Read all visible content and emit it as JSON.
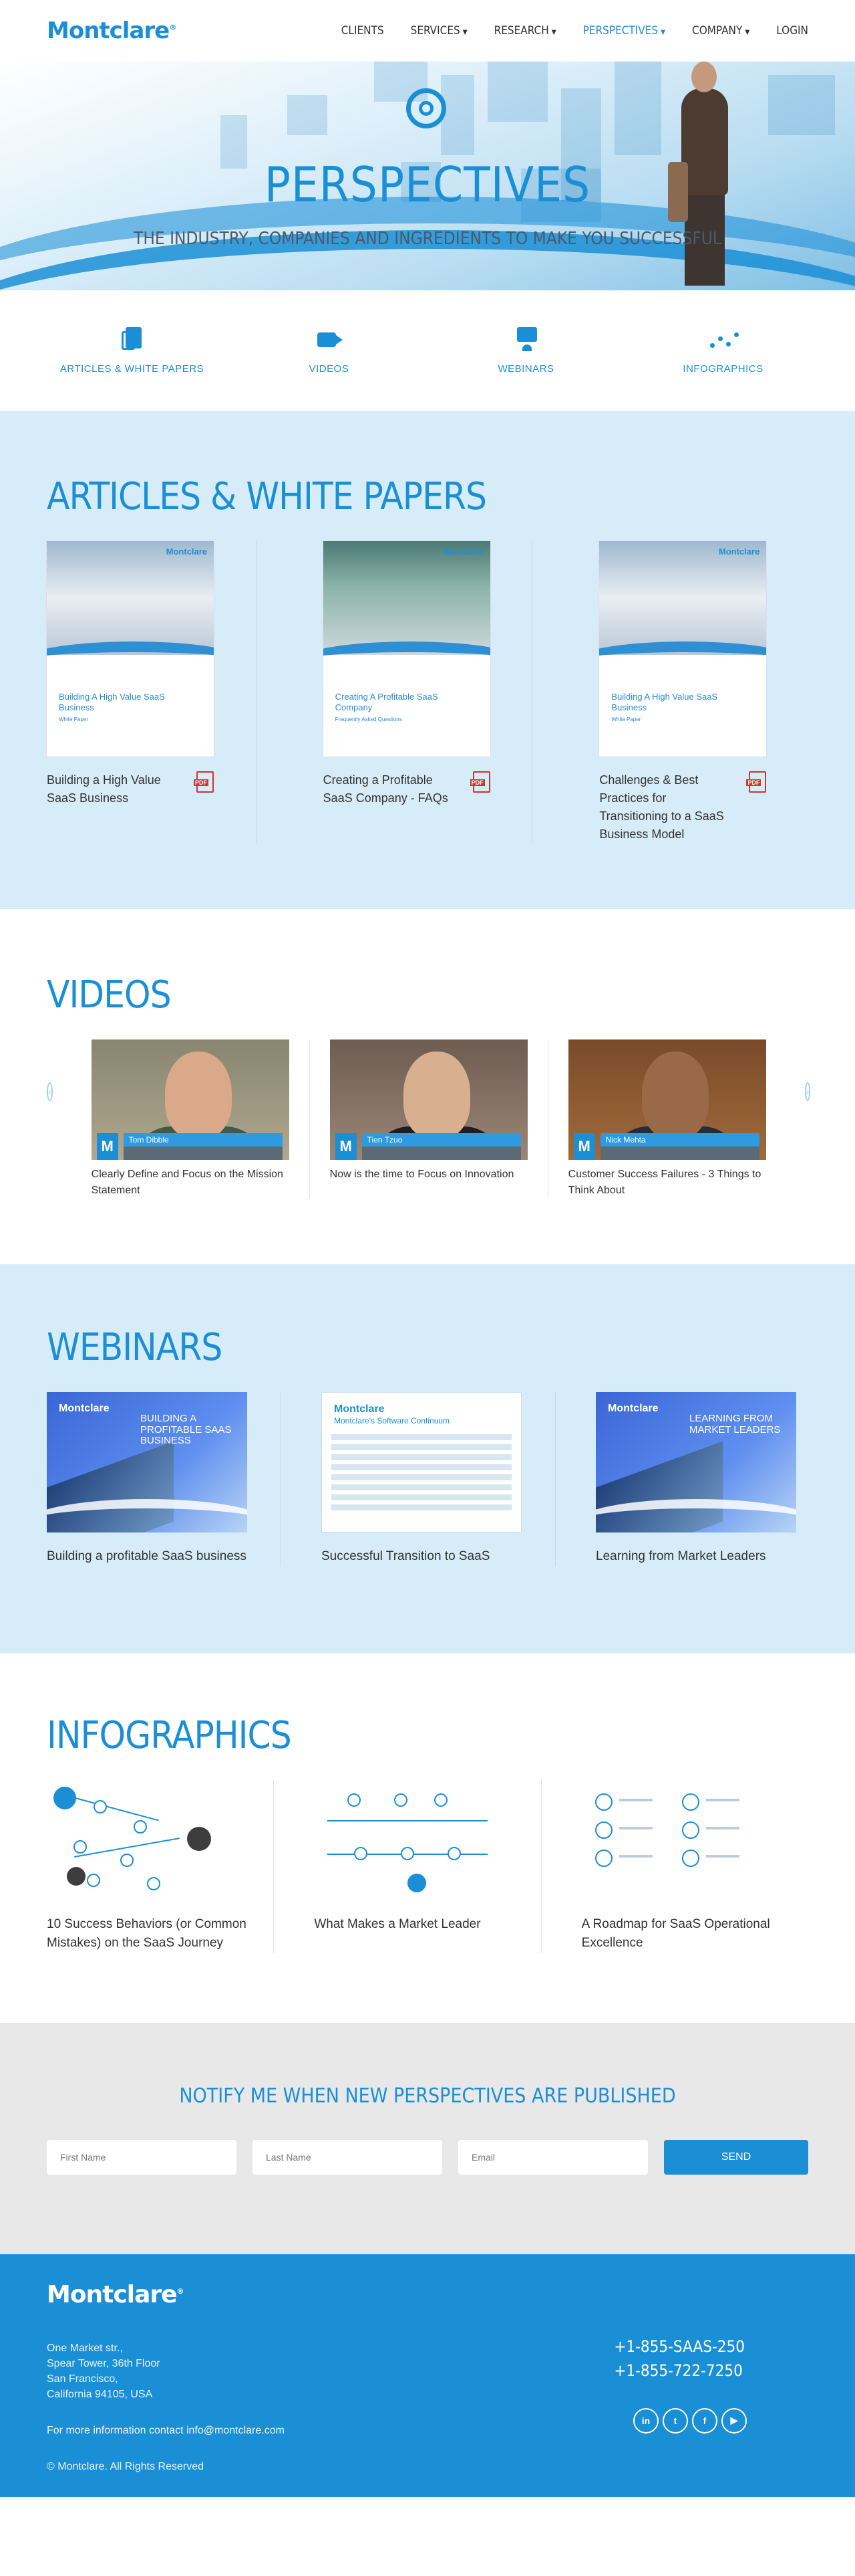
{
  "header": {
    "logo": "Montclare",
    "nav": [
      {
        "label": "CLIENTS",
        "caret": false,
        "active": false
      },
      {
        "label": "SERVICES",
        "caret": true,
        "active": false
      },
      {
        "label": "RESEARCH",
        "caret": true,
        "active": false
      },
      {
        "label": "PERSPECTIVES",
        "caret": true,
        "active": true
      },
      {
        "label": "COMPANY",
        "caret": true,
        "active": false
      },
      {
        "label": "LOGIN",
        "caret": false,
        "active": false
      }
    ]
  },
  "hero": {
    "title": "PERSPECTIVES",
    "subtitle": "THE INDUSTRY, COMPANIES AND INGREDIENTS TO MAKE YOU SUCCESSFUL"
  },
  "categories": [
    {
      "label": "ARTICLES & WHITE PAPERS",
      "icon": "document-icon"
    },
    {
      "label": "VIDEOS",
      "icon": "video-icon"
    },
    {
      "label": "WEBINARS",
      "icon": "webinar-icon"
    },
    {
      "label": "INFOGRAPHICS",
      "icon": "infographic-icon"
    }
  ],
  "articles": {
    "title": "ARTICLES & WHITE PAPERS",
    "items": [
      {
        "cover_brand": "Montclare",
        "cover_title": "Building A High Value SaaS Business",
        "cover_tag": "White Paper",
        "title": "Building a High Value SaaS Business"
      },
      {
        "cover_brand": "Montclare",
        "cover_title": "Creating A Profitable SaaS Company",
        "cover_tag": "Frequently Asked Questions",
        "title": "Creating a Profitable SaaS Company - FAQs"
      },
      {
        "cover_brand": "Montclare",
        "cover_title": "Building A High Value SaaS Business",
        "cover_tag": "White Paper",
        "title": "Challenges & Best Practices for Transitioning to a SaaS Business Model"
      }
    ]
  },
  "videos": {
    "title": "VIDEOS",
    "items": [
      {
        "speaker": "Tom Dibble",
        "caption": "Clearly Define and Focus on the Mission Statement"
      },
      {
        "speaker": "Tien Tzuo",
        "caption": "Now is the time to Focus on Innovation"
      },
      {
        "speaker": "Nick Mehta",
        "caption": "Customer Success Failures - 3 Things to Think About"
      }
    ]
  },
  "webinars": {
    "title": "WEBINARS",
    "items": [
      {
        "brand": "Montclare",
        "thumb_title": "BUILDING A PROFITABLE SAAS BUSINESS",
        "caption": "Building a profitable SaaS business",
        "style": "dark"
      },
      {
        "brand": "Montclare",
        "thumb_title": "Montclare's Software Continuum",
        "caption": "Successful Transition to SaaS",
        "style": "light"
      },
      {
        "brand": "Montclare",
        "thumb_title": "LEARNING FROM MARKET LEADERS",
        "caption": "Learning from Market Leaders",
        "style": "dark"
      }
    ]
  },
  "infographics": {
    "title": "INFOGRAPHICS",
    "items": [
      {
        "caption": "10 Success Behaviors (or Common Mistakes) on the SaaS Journey"
      },
      {
        "caption": "What Makes a Market Leader"
      },
      {
        "caption": "A Roadmap for SaaS Operational Excellence"
      }
    ]
  },
  "notify": {
    "title": "NOTIFY ME WHEN NEW PERSPECTIVES ARE PUBLISHED",
    "first_name_placeholder": "First Name",
    "last_name_placeholder": "Last Name",
    "email_placeholder": "Email",
    "send_label": "SEND"
  },
  "footer": {
    "logo": "Montclare",
    "address": [
      "One Market str.,",
      "Spear Tower, 36th Floor",
      "San Francisco,",
      "California 94105, USA"
    ],
    "contact": "For more information contact info@montclare.com",
    "phones": [
      "+1-855-SAAS-250",
      "+1-855-722-7250"
    ],
    "social": [
      {
        "name": "linkedin-icon",
        "glyph": "in"
      },
      {
        "name": "twitter-icon",
        "glyph": "t"
      },
      {
        "name": "facebook-icon",
        "glyph": "f"
      },
      {
        "name": "youtube-icon",
        "glyph": "▶"
      }
    ],
    "copyright": "© Montclare. All Rights Reserved"
  },
  "colors": {
    "brand": "#1b8fd6",
    "light_section": "#d6ecf8",
    "notify_bg": "#e8e8e8"
  }
}
